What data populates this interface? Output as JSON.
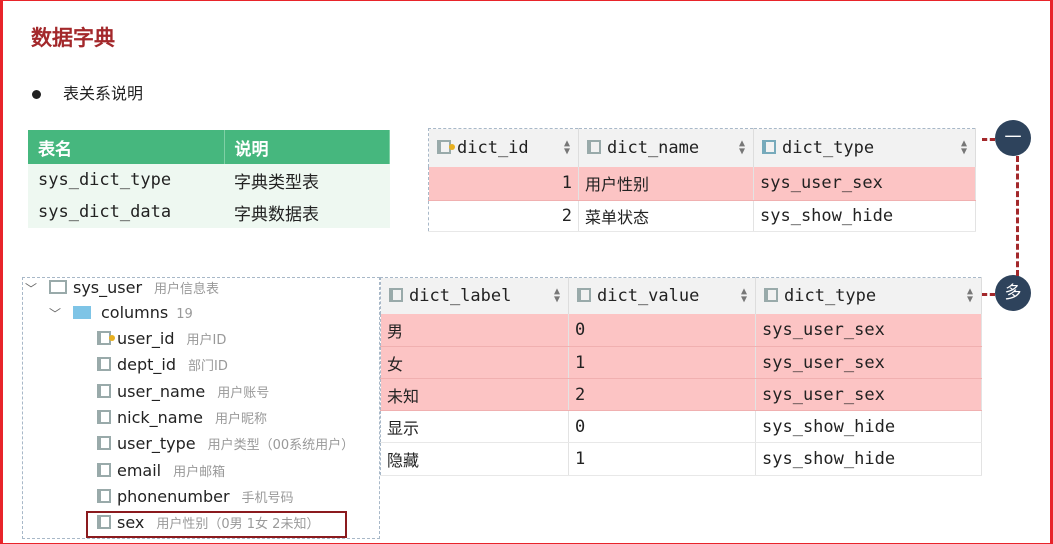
{
  "title": "数据字典",
  "bullet": "表关系说明",
  "table_list": {
    "headers": [
      "表名",
      "说明"
    ],
    "rows": [
      [
        "sys_dict_type",
        "字典类型表"
      ],
      [
        "sys_dict_data",
        "字典数据表"
      ]
    ]
  },
  "dict_type_grid": {
    "headers": [
      "dict_id",
      "dict_name",
      "dict_type"
    ],
    "rows": [
      [
        "1",
        "用户性别",
        "sys_user_sex"
      ],
      [
        "2",
        "菜单状态",
        "sys_show_hide"
      ]
    ],
    "highlighted_rows": [
      0
    ]
  },
  "dict_data_grid": {
    "headers": [
      "dict_label",
      "dict_value",
      "dict_type"
    ],
    "rows": [
      [
        "男",
        "0",
        "sys_user_sex"
      ],
      [
        "女",
        "1",
        "sys_user_sex"
      ],
      [
        "未知",
        "2",
        "sys_user_sex"
      ],
      [
        "显示",
        "0",
        "sys_show_hide"
      ],
      [
        "隐藏",
        "1",
        "sys_show_hide"
      ]
    ],
    "highlighted_rows": [
      0,
      1,
      2
    ]
  },
  "tree": {
    "table": "sys_user",
    "table_comment": "用户信息表",
    "folder": "columns",
    "folder_count": "19",
    "columns": [
      {
        "name": "user_id",
        "comment": "用户ID",
        "key": true
      },
      {
        "name": "dept_id",
        "comment": "部门ID"
      },
      {
        "name": "user_name",
        "comment": "用户账号"
      },
      {
        "name": "nick_name",
        "comment": "用户昵称"
      },
      {
        "name": "user_type",
        "comment": "用户类型（00系统用户）"
      },
      {
        "name": "email",
        "comment": "用户邮箱"
      },
      {
        "name": "phonenumber",
        "comment": "手机号码"
      },
      {
        "name": "sex",
        "comment": "用户性别（0男 1女 2未知）",
        "highlighted": true
      }
    ]
  },
  "relation": {
    "one": "一",
    "many": "多"
  },
  "colors": {
    "title": "#a3282b",
    "header_green": "#46b77e",
    "highlight": "#fcc4c4",
    "circle": "#2e435c"
  }
}
